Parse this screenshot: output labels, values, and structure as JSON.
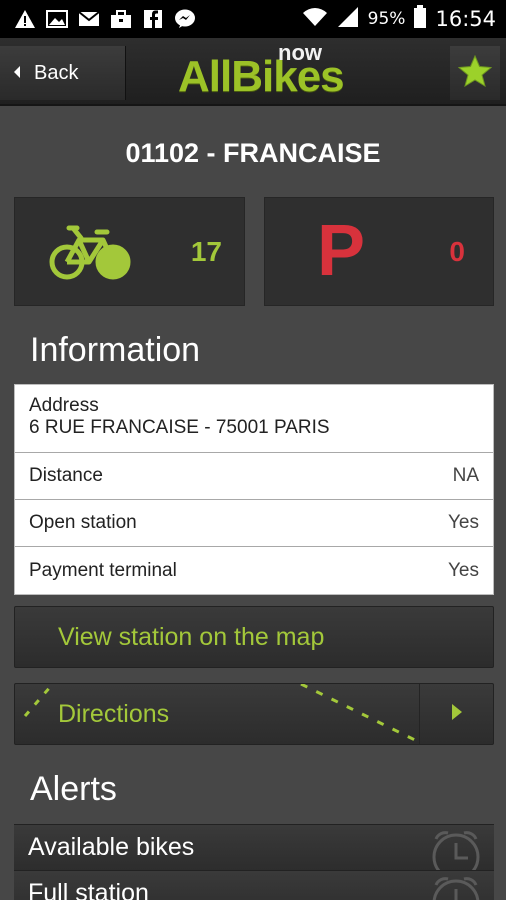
{
  "statusbar": {
    "icons": [
      "warning-icon",
      "image-icon",
      "mail-icon",
      "briefcase-icon",
      "facebook-icon",
      "messenger-icon"
    ],
    "battery_percent": "95%",
    "time": "16:54"
  },
  "actionbar": {
    "back_label": "Back",
    "logo_main": "AllBikes",
    "logo_sub": "now"
  },
  "station": {
    "title": "01102 - FRANCAISE",
    "bikes_available": "17",
    "parking_letter": "P",
    "parking_available": "0"
  },
  "information": {
    "title": "Information",
    "address_label": "Address",
    "address_value": "6 RUE FRANCAISE - 75001 PARIS",
    "rows": [
      {
        "label": "Distance",
        "value": "NA"
      },
      {
        "label": "Open station",
        "value": "Yes"
      },
      {
        "label": "Payment terminal",
        "value": "Yes"
      }
    ]
  },
  "actions": {
    "map_label": "View station on the map",
    "directions_label": "Directions"
  },
  "alerts": {
    "title": "Alerts",
    "items": [
      {
        "label": "Available bikes"
      },
      {
        "label": "Full station"
      }
    ]
  },
  "colors": {
    "accent_green": "#a3c83a",
    "accent_red": "#d8323c",
    "background": "#474747"
  }
}
